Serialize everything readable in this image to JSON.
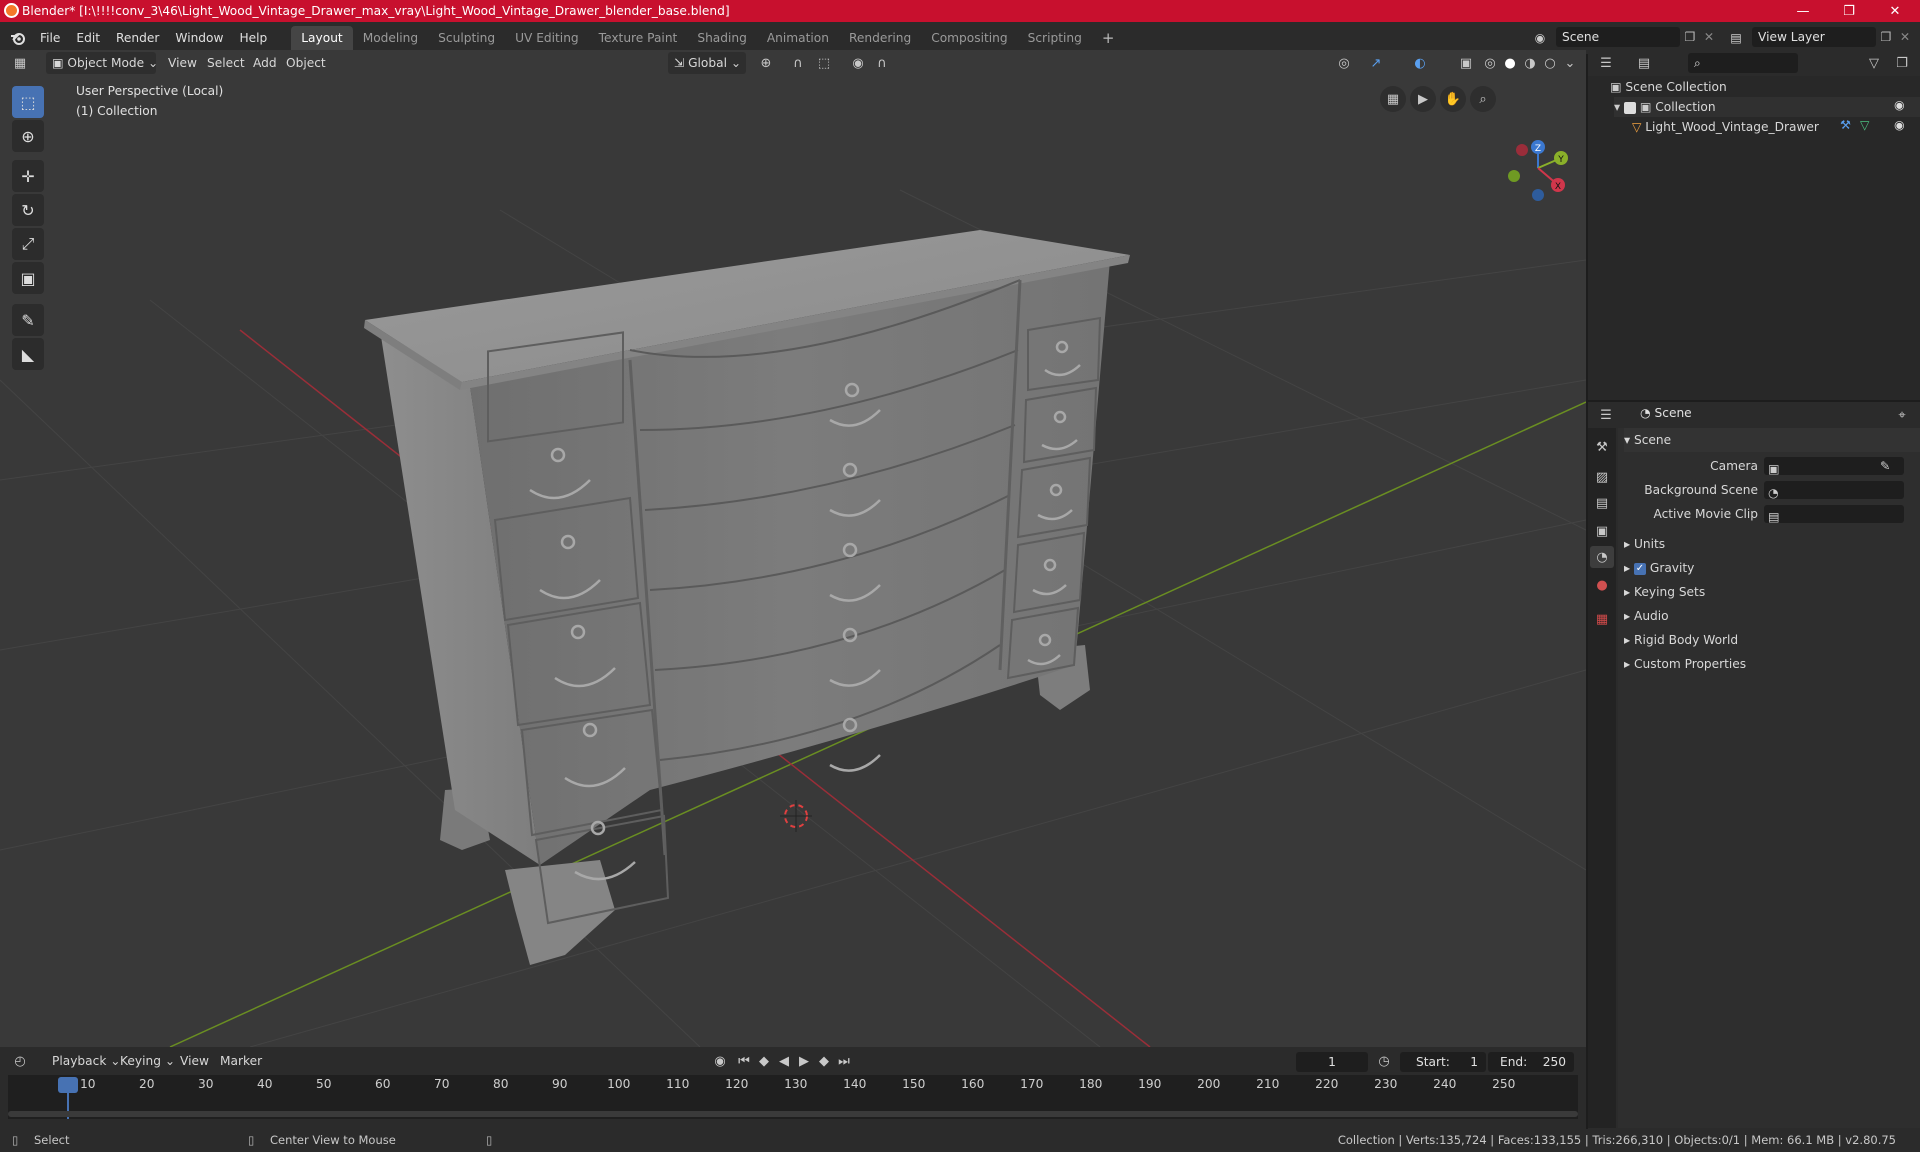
{
  "titlebar": {
    "title": "Blender* [I:\\!!!!conv_3\\46\\Light_Wood_Vintage_Drawer_max_vray\\Light_Wood_Vintage_Drawer_blender_base.blend]",
    "color": "#c8102e"
  },
  "menu": {
    "items": [
      "File",
      "Edit",
      "Render",
      "Window",
      "Help"
    ]
  },
  "workspaces": [
    "Layout",
    "Modeling",
    "Sculpting",
    "UV Editing",
    "Texture Paint",
    "Shading",
    "Animation",
    "Rendering",
    "Compositing",
    "Scripting"
  ],
  "scene_field": "Scene",
  "view_layer_field": "View Layer",
  "viewport_header": {
    "mode": "Object Mode",
    "menus": [
      "View",
      "Select",
      "Add",
      "Object"
    ],
    "transform_orientation": "Global"
  },
  "viewport": {
    "perspective_label": "User Perspective (Local)",
    "collection_label": "(1) Collection",
    "gizmo_axes": [
      "Z",
      "Y",
      "X"
    ]
  },
  "outliner": {
    "root": "Scene Collection",
    "collection": "Collection",
    "object": "Light_Wood_Vintage_Drawer"
  },
  "properties": {
    "header_title": "Scene",
    "section_title": "Scene",
    "fields": [
      {
        "label": "Camera",
        "value": ""
      },
      {
        "label": "Background Scene",
        "value": ""
      },
      {
        "label": "Active Movie Clip",
        "value": ""
      }
    ],
    "panels": [
      "Units",
      "Gravity",
      "Keying Sets",
      "Audio",
      "Rigid Body World",
      "Custom Properties"
    ],
    "gravity_checked": true
  },
  "timeline": {
    "menus": [
      "Playback",
      "Keying",
      "View",
      "Marker"
    ],
    "current_frame": "1",
    "start_label": "Start:",
    "start_value": "1",
    "end_label": "End:",
    "end_value": "250",
    "ticks": [
      "1",
      "10",
      "20",
      "30",
      "40",
      "50",
      "60",
      "70",
      "80",
      "90",
      "100",
      "110",
      "120",
      "130",
      "140",
      "150",
      "160",
      "170",
      "180",
      "190",
      "200",
      "210",
      "220",
      "230",
      "240",
      "250"
    ]
  },
  "statusbar": {
    "left_action": "Select",
    "mid_action": "Center View to Mouse",
    "stats": "Collection | Verts:135,724 | Faces:133,155 | Tris:266,310 | Objects:0/1 | Mem: 66.1 MB | v2.80.75"
  }
}
